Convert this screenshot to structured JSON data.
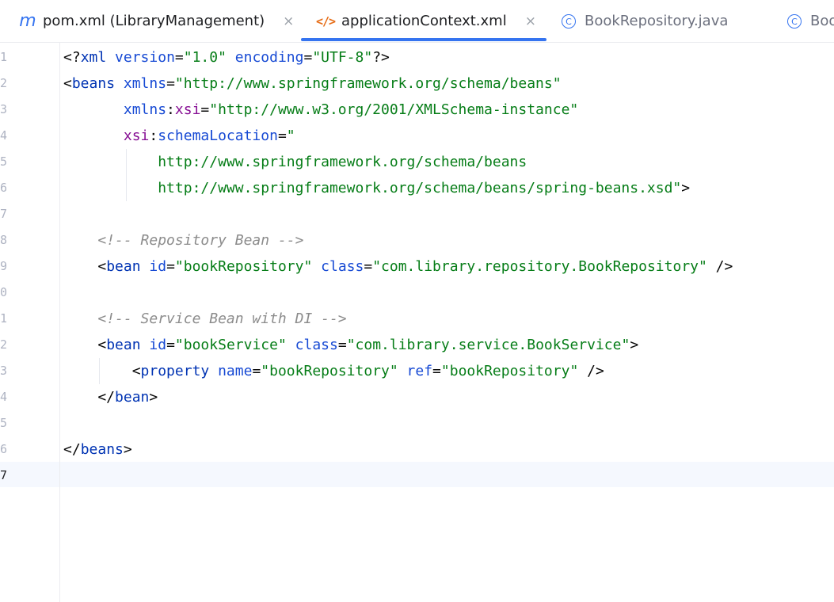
{
  "tabs": [
    {
      "icon": "maven-icon",
      "glyph": "m",
      "label": "pom.xml (LibraryManagement)",
      "close": "×",
      "active": false
    },
    {
      "icon": "xml-file-icon",
      "glyph": "</>",
      "label": "applicationContext.xml",
      "close": "×",
      "active": true
    },
    {
      "icon": "java-class-icon",
      "glyph": "C",
      "label": "BookRepository.java",
      "active": false
    },
    {
      "icon": "java-class-icon",
      "glyph": "C",
      "label": "BookService.java",
      "active": false
    }
  ],
  "colors": {
    "accent": "#3574f0",
    "xml_icon": "#e66d17",
    "tag": "#0033b3",
    "attribute": "#174ad4",
    "namespace": "#871094",
    "string": "#067d17",
    "comment": "#8c8c8c"
  },
  "editor": {
    "current_line": "7",
    "line_numbers": [
      "1",
      "2",
      "3",
      "4",
      "5",
      "6",
      "7",
      "8",
      "9",
      "0",
      "1",
      "2",
      "3",
      "4",
      "5",
      "6",
      "7"
    ],
    "lines": [
      [
        [
          "punct",
          "<?"
        ],
        [
          "tag",
          "xml"
        ],
        [
          "punct",
          " "
        ],
        [
          "attr",
          "version"
        ],
        [
          "punct",
          "="
        ],
        [
          "str",
          "\"1.0\""
        ],
        [
          "punct",
          " "
        ],
        [
          "attr",
          "encoding"
        ],
        [
          "punct",
          "="
        ],
        [
          "str",
          "\"UTF-8\""
        ],
        [
          "punct",
          "?>"
        ]
      ],
      [
        [
          "punct",
          "<"
        ],
        [
          "tag",
          "beans"
        ],
        [
          "punct",
          " "
        ],
        [
          "attr",
          "xmlns"
        ],
        [
          "punct",
          "="
        ],
        [
          "str",
          "\"http://www.springframework.org/schema/beans\""
        ]
      ],
      [
        [
          "punct",
          "       "
        ],
        [
          "attr",
          "xmlns"
        ],
        [
          "punct",
          ":"
        ],
        [
          "ns",
          "xsi"
        ],
        [
          "punct",
          "="
        ],
        [
          "str",
          "\"http://www.w3.org/2001/XMLSchema-instance\""
        ]
      ],
      [
        [
          "punct",
          "       "
        ],
        [
          "ns",
          "xsi"
        ],
        [
          "punct",
          ":"
        ],
        [
          "attr",
          "schemaLocation"
        ],
        [
          "punct",
          "="
        ],
        [
          "str",
          "\""
        ]
      ],
      [
        [
          "punct",
          "           "
        ],
        [
          "str",
          "http://www.springframework.org/schema/beans"
        ]
      ],
      [
        [
          "punct",
          "           "
        ],
        [
          "str",
          "http://www.springframework.org/schema/beans/spring-beans.xsd\""
        ],
        [
          "punct",
          ">"
        ]
      ],
      [],
      [
        [
          "punct",
          "    "
        ],
        [
          "comm",
          "<!-- Repository Bean -->"
        ]
      ],
      [
        [
          "punct",
          "    <"
        ],
        [
          "tag",
          "bean"
        ],
        [
          "punct",
          " "
        ],
        [
          "attr",
          "id"
        ],
        [
          "punct",
          "="
        ],
        [
          "str",
          "\"bookRepository\""
        ],
        [
          "punct",
          " "
        ],
        [
          "attr",
          "class"
        ],
        [
          "punct",
          "="
        ],
        [
          "str",
          "\"com.library.repository.BookRepository\""
        ],
        [
          "punct",
          " />"
        ]
      ],
      [],
      [
        [
          "punct",
          "    "
        ],
        [
          "comm",
          "<!-- Service Bean with DI -->"
        ]
      ],
      [
        [
          "punct",
          "    <"
        ],
        [
          "tag",
          "bean"
        ],
        [
          "punct",
          " "
        ],
        [
          "attr",
          "id"
        ],
        [
          "punct",
          "="
        ],
        [
          "str",
          "\"bookService\""
        ],
        [
          "punct",
          " "
        ],
        [
          "attr",
          "class"
        ],
        [
          "punct",
          "="
        ],
        [
          "str",
          "\"com.library.service.BookService\""
        ],
        [
          "punct",
          ">"
        ]
      ],
      [
        [
          "punct",
          "        <"
        ],
        [
          "tag",
          "property"
        ],
        [
          "punct",
          " "
        ],
        [
          "attr",
          "name"
        ],
        [
          "punct",
          "="
        ],
        [
          "str",
          "\"bookRepository\""
        ],
        [
          "punct",
          " "
        ],
        [
          "attr",
          "ref"
        ],
        [
          "punct",
          "="
        ],
        [
          "str",
          "\"bookRepository\""
        ],
        [
          "punct",
          " />"
        ]
      ],
      [
        [
          "punct",
          "    </"
        ],
        [
          "tag",
          "bean"
        ],
        [
          "punct",
          ">"
        ]
      ],
      [],
      [
        [
          "punct",
          "</"
        ],
        [
          "tag",
          "beans"
        ],
        [
          "punct",
          ">"
        ]
      ],
      []
    ]
  }
}
